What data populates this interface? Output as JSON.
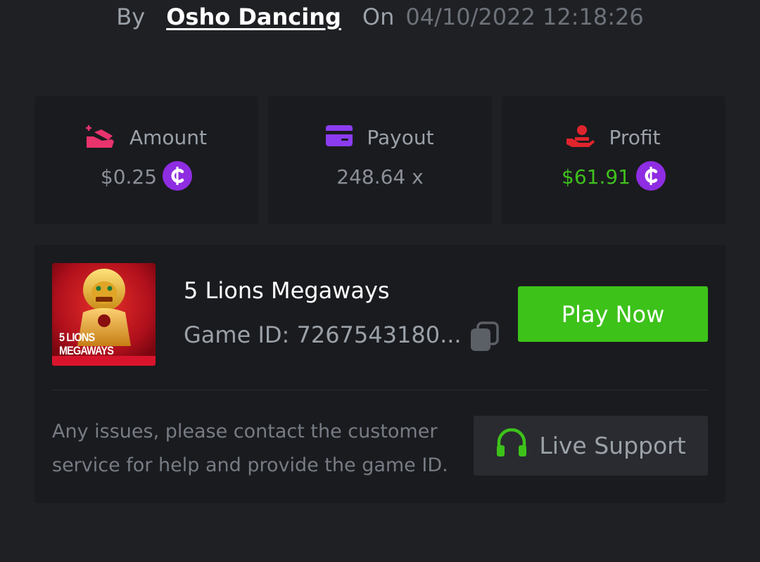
{
  "header": {
    "by_label": "By",
    "user_name": "Osho Dancing",
    "on_label": "On",
    "datetime": "04/10/2022 12:18:26"
  },
  "stats": {
    "amount": {
      "label": "Amount",
      "value": "$0.25",
      "icon": "hand-coins-icon",
      "icon_color": "#e8336d"
    },
    "payout": {
      "label": "Payout",
      "value": "248.64 x",
      "icon": "credit-card-icon",
      "icon_color": "#8b3cf0"
    },
    "profit": {
      "label": "Profit",
      "value": "$61.91",
      "icon": "hand-money-icon",
      "icon_color": "#e0242c",
      "value_color": "#3fc01d"
    },
    "coin_symbol": "₵",
    "coin_color": "#8e2de2"
  },
  "game": {
    "thumbnail_line1": "5 LIONS",
    "thumbnail_line2": "MEGAWAYS",
    "title": "5 Lions Megaways",
    "id_text": "Game ID: 7267543180...",
    "play_label": "Play Now",
    "play_color": "#3dc21a"
  },
  "support": {
    "notice": "Any issues, please contact the customer service for help and provide the game ID.",
    "button_label": "Live Support",
    "icon": "headset-icon"
  }
}
